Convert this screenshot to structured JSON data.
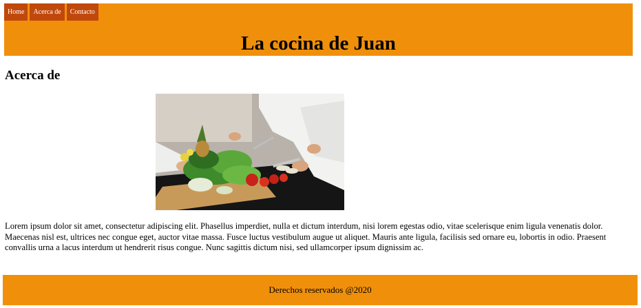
{
  "nav": {
    "items": [
      {
        "label": "Home"
      },
      {
        "label": "Acerca de"
      },
      {
        "label": "Contacto"
      }
    ]
  },
  "header": {
    "title": "La cocina de Juan"
  },
  "main": {
    "heading": "Acerca de",
    "paragraph": "Lorem ipsum dolor sit amet, consectetur adipiscing elit. Phasellus imperdiet, nulla et dictum interdum, nisi lorem egestas odio, vitae scelerisque enim ligula venenatis dolor. Maecenas nisl est, ultrices nec congue eget, auctor vitae massa. Fusce luctus vestibulum augue ut aliquet. Mauris ante ligula, facilisis sed ornare eu, lobortis in odio. Praesent convallis urna a lacus interdum ut hendrerit risus congue. Nunc sagittis dictum nisi, sed ullamcorper ipsum dignissim ac."
  },
  "footer": {
    "text": "Derechos reservados @2020"
  },
  "colors": {
    "header_bg": "#f0900a",
    "nav_bg": "#c0480c",
    "footer_bg": "#f0900a"
  }
}
